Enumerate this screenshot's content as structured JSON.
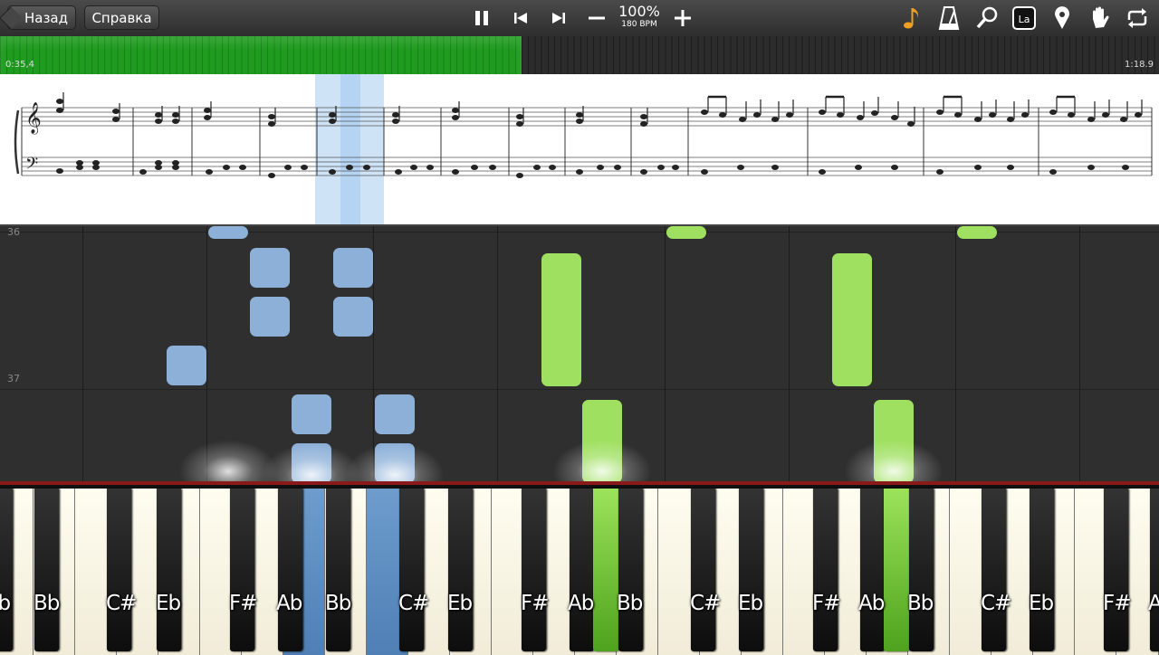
{
  "toolbar": {
    "back_label": "Назад",
    "help_label": "Справка",
    "speed_percent": "100%",
    "bpm": "180 BPM",
    "icons": [
      "pause-icon",
      "previous-icon",
      "next-icon",
      "minus-icon",
      "plus-icon",
      "note-icon",
      "metronome-icon",
      "zoom-icon",
      "note-labels-icon",
      "location-icon",
      "hand-icon",
      "loop-icon"
    ],
    "note_labels_text": "La"
  },
  "progress": {
    "current_time": "0:35,4",
    "total_time": "1:18.9",
    "fraction": 0.45,
    "color": "#1f9c1f"
  },
  "roll": {
    "measure_numbers": [
      "36",
      "37"
    ],
    "left_hand_color": "#8db0d8",
    "right_hand_color": "#9fe060"
  },
  "keyboard": {
    "labels": [
      "Eb",
      "Bb",
      "C#",
      "Eb",
      "F#",
      "Ab",
      "Bb",
      "C#",
      "Eb",
      "F#",
      "Ab",
      "Bb",
      "C#",
      "Eb",
      "F#",
      "Ab",
      "Bb",
      "C#",
      "Eb",
      "F#",
      "Ab"
    ]
  }
}
